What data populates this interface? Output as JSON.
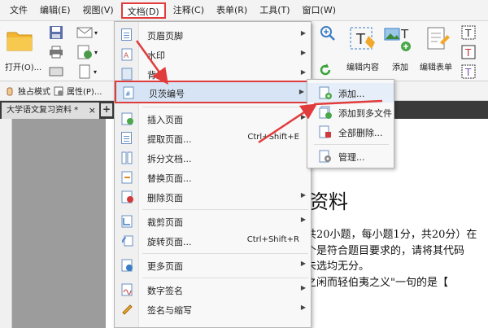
{
  "menubar": {
    "items": [
      "文件",
      "编辑(E)",
      "视图(V)",
      "文档(D)",
      "注释(C)",
      "表单(R)",
      "工具(T)",
      "窗口(W)"
    ]
  },
  "ribbon": {
    "open_label": "打开(O)...",
    "edit_content_label": "编辑内容",
    "add_label": "添加",
    "edit_form_label": "编辑表单"
  },
  "toolbar2": {
    "solo_mode": "独占模式",
    "properties": "属性(P)..."
  },
  "tab": {
    "title": "大学语文复习资料 *",
    "close": "×",
    "add": "+"
  },
  "document": {
    "title": "资料",
    "lines": [
      "共20小题，每小题1分，共20分）在",
      "个是符合题目要求的，请将其代码",
      "未选均无分。",
      "之闲而轻伯夷之义\"一句的是【"
    ]
  },
  "menu": {
    "items": [
      {
        "label": "页眉页脚",
        "shortcut": "",
        "arrow": "▶"
      },
      {
        "label": "水印",
        "shortcut": "",
        "arrow": "▶"
      },
      {
        "label": "背景",
        "shortcut": "",
        "arrow": "▶"
      },
      {
        "label": "贝茨编号",
        "shortcut": "",
        "arrow": "▶"
      },
      {
        "label": "插入页面",
        "shortcut": "",
        "arrow": "▶"
      },
      {
        "label": "提取页面...",
        "shortcut": "Ctrl+Shift+E",
        "arrow": ""
      },
      {
        "label": "拆分文档...",
        "shortcut": "",
        "arrow": ""
      },
      {
        "label": "替换页面...",
        "shortcut": "",
        "arrow": ""
      },
      {
        "label": "删除页面",
        "shortcut": "",
        "arrow": "▶"
      },
      {
        "label": "裁剪页面",
        "shortcut": "",
        "arrow": "▶"
      },
      {
        "label": "旋转页面...",
        "shortcut": "Ctrl+Shift+R",
        "arrow": ""
      },
      {
        "label": "更多页面",
        "shortcut": "",
        "arrow": "▶"
      },
      {
        "label": "数字签名",
        "shortcut": "",
        "arrow": "▶"
      },
      {
        "label": "签名与缩写",
        "shortcut": "",
        "arrow": "▶"
      }
    ]
  },
  "submenu": {
    "items": [
      "添加...",
      "添加到多文件",
      "全部删除...",
      "管理..."
    ]
  },
  "colors": {
    "highlight_border": "#e03c3c",
    "menu_highlight": "#d6e4f5"
  }
}
